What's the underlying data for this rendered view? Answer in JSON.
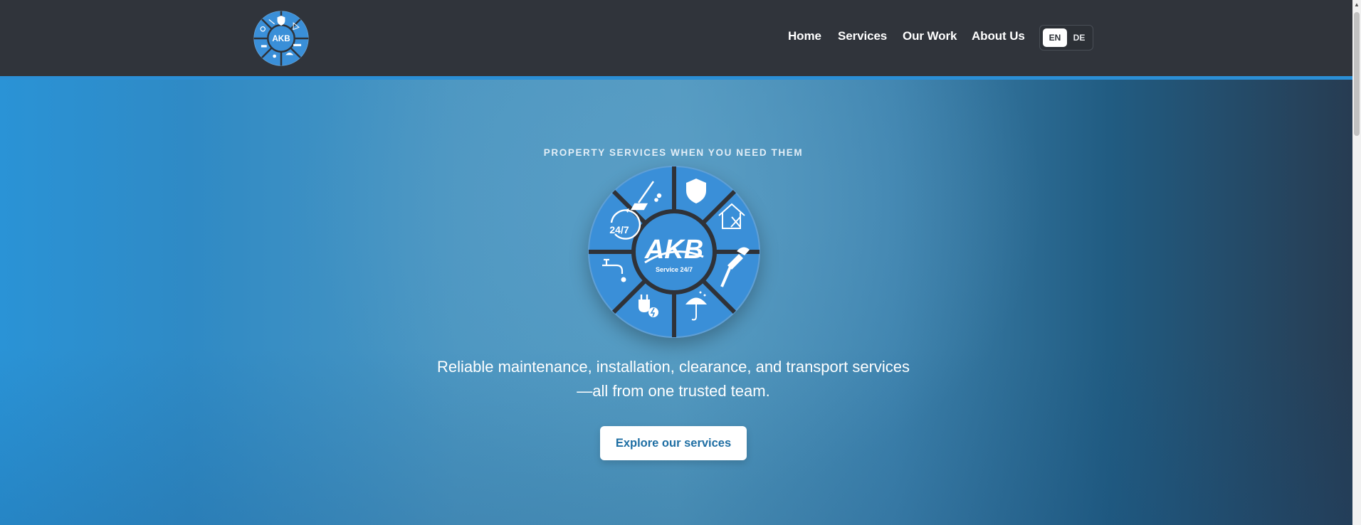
{
  "header": {
    "logo_text": "AKB",
    "nav": [
      {
        "label": "Home"
      },
      {
        "label": "Services"
      },
      {
        "label": "Our Work"
      },
      {
        "label": "About Us"
      }
    ],
    "languages": {
      "active": "EN",
      "other": "DE"
    }
  },
  "hero": {
    "tagline": "PROPERTY SERVICES WHEN YOU NEED THEM",
    "logo": {
      "brand": "AKB",
      "caption": "Service 24/7",
      "clock_text": "24/7"
    },
    "subtitle_line1": "Reliable maintenance, installation, clearance, and transport services",
    "subtitle_line2": "—all from one trusted team.",
    "cta_label": "Explore our services"
  },
  "icons": {
    "segments": [
      "cleaning-icon",
      "shield-icon",
      "house-tools-icon",
      "hammer-icon",
      "umbrella-icon",
      "plug-icon",
      "faucet-icon",
      "clock-24-7-icon"
    ]
  },
  "colors": {
    "header_bg": "#30343b",
    "accent": "#2b8fd6",
    "logo_blue": "#3a8fd8",
    "logo_dark": "#2f3238",
    "cta_text": "#1e6ea3"
  }
}
